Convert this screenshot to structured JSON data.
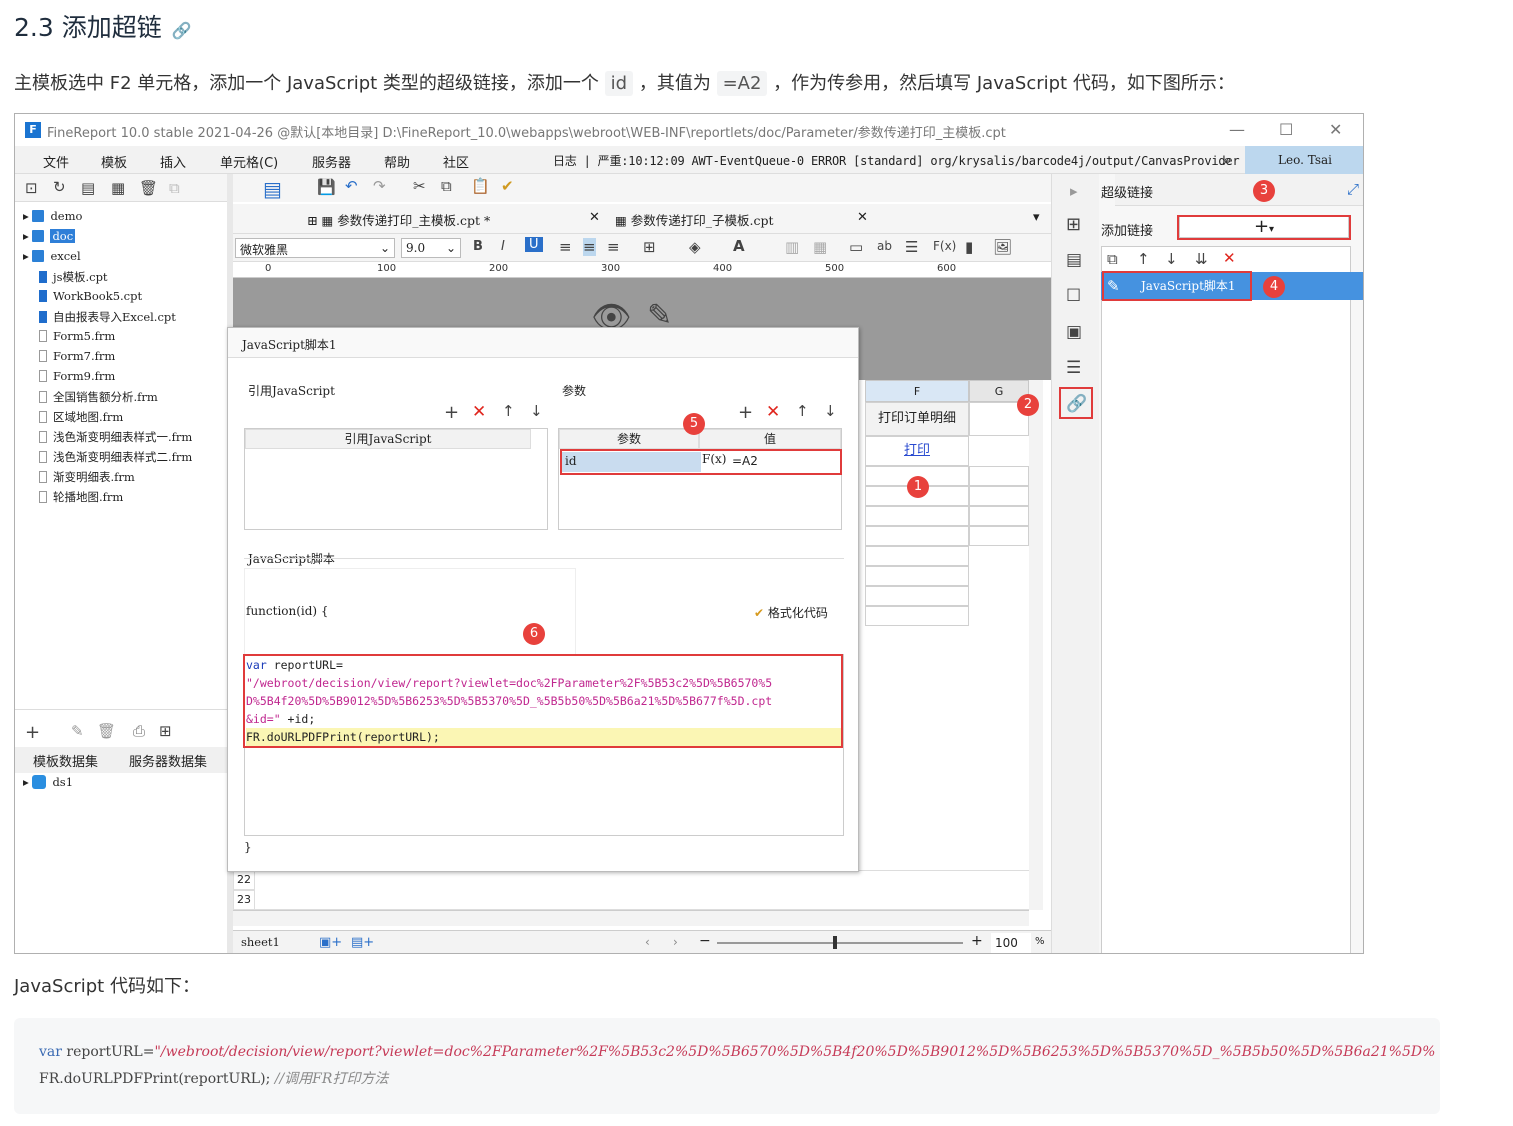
{
  "heading": {
    "title": "2.3 添加超链",
    "link_icon": "🔗"
  },
  "intro": {
    "p1": "主模板选中 F2 单元格，添加一个 JavaScript 类型的超级链接，添加一个",
    "c1": "id",
    "p2": "，其值为",
    "c2": "=A2",
    "p3": "，作为传参用，然后填写 JavaScript 代码，如下图所示："
  },
  "app": {
    "title": "FineReport 10.0 stable 2021-04-26 @默认[本地目录]     D:\\FineReport_10.0\\webapps\\webroot\\WEB-INF\\reportlets/doc/Parameter/参数传递打印_主模板.cpt",
    "menus": [
      "文件",
      "模板",
      "插入",
      "单元格(C)",
      "服务器",
      "帮助",
      "社区"
    ],
    "log": "日志 | 严重:10:12:09 AWT-EventQueue-0 ERROR [standard] org/krysalis/barcode4j/output/CanvasProvider",
    "user": "Leo. Tsai",
    "tree": [
      {
        "label": "demo",
        "type": "folder"
      },
      {
        "label": "doc",
        "type": "folder",
        "selected": true
      },
      {
        "label": "excel",
        "type": "folder"
      },
      {
        "label": "js模板.cpt",
        "type": "cpt"
      },
      {
        "label": "WorkBook5.cpt",
        "type": "cpt"
      },
      {
        "label": "自由报表导入Excel.cpt",
        "type": "cpt"
      },
      {
        "label": "Form5.frm",
        "type": "frm"
      },
      {
        "label": "Form7.frm",
        "type": "frm"
      },
      {
        "label": "Form9.frm",
        "type": "frm"
      },
      {
        "label": "全国销售额分析.frm",
        "type": "frm"
      },
      {
        "label": "区域地图.frm",
        "type": "frm"
      },
      {
        "label": "浅色渐变明细表样式一.frm",
        "type": "frm"
      },
      {
        "label": "浅色渐变明细表样式二.frm",
        "type": "frm"
      },
      {
        "label": "渐变明细表.frm",
        "type": "frm"
      },
      {
        "label": "轮播地图.frm",
        "type": "frm"
      }
    ],
    "dataset_tabs": [
      "模板数据集",
      "服务器数据集"
    ],
    "dataset": "ds1",
    "tabs": [
      {
        "label": "参数传递打印_主模板.cpt *"
      },
      {
        "label": "参数传递打印_子模板.cpt"
      }
    ],
    "font": "微软雅黑",
    "font_size": "9.0",
    "ruler": [
      "0",
      "100",
      "200",
      "300",
      "400",
      "500",
      "600"
    ],
    "col_f": "F",
    "col_g": "G",
    "cell_header": "打印订单明细",
    "cell_link": "打印",
    "rows": [
      "22",
      "23"
    ],
    "sheet": "sheet1",
    "zoom": "100",
    "zoom_unit": "%",
    "right_panel": {
      "title": "超级链接",
      "add_label": "添加链接",
      "add_symbol": "+",
      "item": "JavaScript脚本1"
    },
    "dialog": {
      "title": "JavaScript脚本1",
      "ref_label": "引用JavaScript",
      "param_label": "参数",
      "ref_header": "引用JavaScript",
      "param_header": "参数",
      "value_header": "值",
      "param_name": "id",
      "param_fx": "F(x)",
      "param_value": "=A2",
      "script_label": "JavaScript脚本",
      "func_open": "function(id) {",
      "format_btn": "格式化代码",
      "func_close": "}",
      "code": {
        "kw": "var",
        "l1": " reportURL=",
        "l2": "\"/webroot/decision/view/report?viewlet=doc%2FParameter%2F%5B53c2%5D%5B6570%5",
        "l3": "D%5B4f20%5D%5B9012%5D%5B6253%5D%5B5370%5D_%5B5b50%5D%5B6a21%5D%5B677f%5D.cpt",
        "l4": "&id=\"",
        "l4b": " +id;",
        "l5": "FR.doURLPDFPrint(reportURL);"
      }
    },
    "badges": [
      "1",
      "2",
      "3",
      "4",
      "5",
      "6"
    ]
  },
  "caption": "JavaScript 代码如下：",
  "codeblock": {
    "kw": "var",
    "l1a": "  reportURL=",
    "l1b": "\"/webroot/decision/view/report?viewlet=doc%2FParameter%2F%5B53c2%5D%5B6570%5D%5B4f20%5D%5B9012%5D%5B6253%5D%5B5370%5D_%5B5b50%5D%5B6a21%5D%",
    "l2": "FR.doURLPDFPrint(reportURL);  ",
    "comment": "//调用FR打印方法"
  }
}
